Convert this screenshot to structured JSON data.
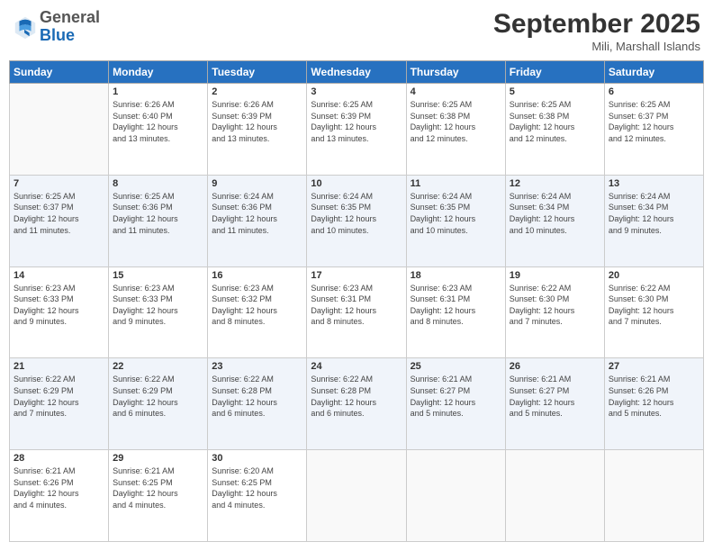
{
  "header": {
    "logo_general": "General",
    "logo_blue": "Blue",
    "title": "September 2025",
    "location": "Mili, Marshall Islands"
  },
  "days_of_week": [
    "Sunday",
    "Monday",
    "Tuesday",
    "Wednesday",
    "Thursday",
    "Friday",
    "Saturday"
  ],
  "weeks": [
    [
      {
        "num": "",
        "info": ""
      },
      {
        "num": "1",
        "info": "Sunrise: 6:26 AM\nSunset: 6:40 PM\nDaylight: 12 hours\nand 13 minutes."
      },
      {
        "num": "2",
        "info": "Sunrise: 6:26 AM\nSunset: 6:39 PM\nDaylight: 12 hours\nand 13 minutes."
      },
      {
        "num": "3",
        "info": "Sunrise: 6:25 AM\nSunset: 6:39 PM\nDaylight: 12 hours\nand 13 minutes."
      },
      {
        "num": "4",
        "info": "Sunrise: 6:25 AM\nSunset: 6:38 PM\nDaylight: 12 hours\nand 12 minutes."
      },
      {
        "num": "5",
        "info": "Sunrise: 6:25 AM\nSunset: 6:38 PM\nDaylight: 12 hours\nand 12 minutes."
      },
      {
        "num": "6",
        "info": "Sunrise: 6:25 AM\nSunset: 6:37 PM\nDaylight: 12 hours\nand 12 minutes."
      }
    ],
    [
      {
        "num": "7",
        "info": "Sunrise: 6:25 AM\nSunset: 6:37 PM\nDaylight: 12 hours\nand 11 minutes."
      },
      {
        "num": "8",
        "info": "Sunrise: 6:25 AM\nSunset: 6:36 PM\nDaylight: 12 hours\nand 11 minutes."
      },
      {
        "num": "9",
        "info": "Sunrise: 6:24 AM\nSunset: 6:36 PM\nDaylight: 12 hours\nand 11 minutes."
      },
      {
        "num": "10",
        "info": "Sunrise: 6:24 AM\nSunset: 6:35 PM\nDaylight: 12 hours\nand 10 minutes."
      },
      {
        "num": "11",
        "info": "Sunrise: 6:24 AM\nSunset: 6:35 PM\nDaylight: 12 hours\nand 10 minutes."
      },
      {
        "num": "12",
        "info": "Sunrise: 6:24 AM\nSunset: 6:34 PM\nDaylight: 12 hours\nand 10 minutes."
      },
      {
        "num": "13",
        "info": "Sunrise: 6:24 AM\nSunset: 6:34 PM\nDaylight: 12 hours\nand 9 minutes."
      }
    ],
    [
      {
        "num": "14",
        "info": "Sunrise: 6:23 AM\nSunset: 6:33 PM\nDaylight: 12 hours\nand 9 minutes."
      },
      {
        "num": "15",
        "info": "Sunrise: 6:23 AM\nSunset: 6:33 PM\nDaylight: 12 hours\nand 9 minutes."
      },
      {
        "num": "16",
        "info": "Sunrise: 6:23 AM\nSunset: 6:32 PM\nDaylight: 12 hours\nand 8 minutes."
      },
      {
        "num": "17",
        "info": "Sunrise: 6:23 AM\nSunset: 6:31 PM\nDaylight: 12 hours\nand 8 minutes."
      },
      {
        "num": "18",
        "info": "Sunrise: 6:23 AM\nSunset: 6:31 PM\nDaylight: 12 hours\nand 8 minutes."
      },
      {
        "num": "19",
        "info": "Sunrise: 6:22 AM\nSunset: 6:30 PM\nDaylight: 12 hours\nand 7 minutes."
      },
      {
        "num": "20",
        "info": "Sunrise: 6:22 AM\nSunset: 6:30 PM\nDaylight: 12 hours\nand 7 minutes."
      }
    ],
    [
      {
        "num": "21",
        "info": "Sunrise: 6:22 AM\nSunset: 6:29 PM\nDaylight: 12 hours\nand 7 minutes."
      },
      {
        "num": "22",
        "info": "Sunrise: 6:22 AM\nSunset: 6:29 PM\nDaylight: 12 hours\nand 6 minutes."
      },
      {
        "num": "23",
        "info": "Sunrise: 6:22 AM\nSunset: 6:28 PM\nDaylight: 12 hours\nand 6 minutes."
      },
      {
        "num": "24",
        "info": "Sunrise: 6:22 AM\nSunset: 6:28 PM\nDaylight: 12 hours\nand 6 minutes."
      },
      {
        "num": "25",
        "info": "Sunrise: 6:21 AM\nSunset: 6:27 PM\nDaylight: 12 hours\nand 5 minutes."
      },
      {
        "num": "26",
        "info": "Sunrise: 6:21 AM\nSunset: 6:27 PM\nDaylight: 12 hours\nand 5 minutes."
      },
      {
        "num": "27",
        "info": "Sunrise: 6:21 AM\nSunset: 6:26 PM\nDaylight: 12 hours\nand 5 minutes."
      }
    ],
    [
      {
        "num": "28",
        "info": "Sunrise: 6:21 AM\nSunset: 6:26 PM\nDaylight: 12 hours\nand 4 minutes."
      },
      {
        "num": "29",
        "info": "Sunrise: 6:21 AM\nSunset: 6:25 PM\nDaylight: 12 hours\nand 4 minutes."
      },
      {
        "num": "30",
        "info": "Sunrise: 6:20 AM\nSunset: 6:25 PM\nDaylight: 12 hours\nand 4 minutes."
      },
      {
        "num": "",
        "info": ""
      },
      {
        "num": "",
        "info": ""
      },
      {
        "num": "",
        "info": ""
      },
      {
        "num": "",
        "info": ""
      }
    ]
  ]
}
